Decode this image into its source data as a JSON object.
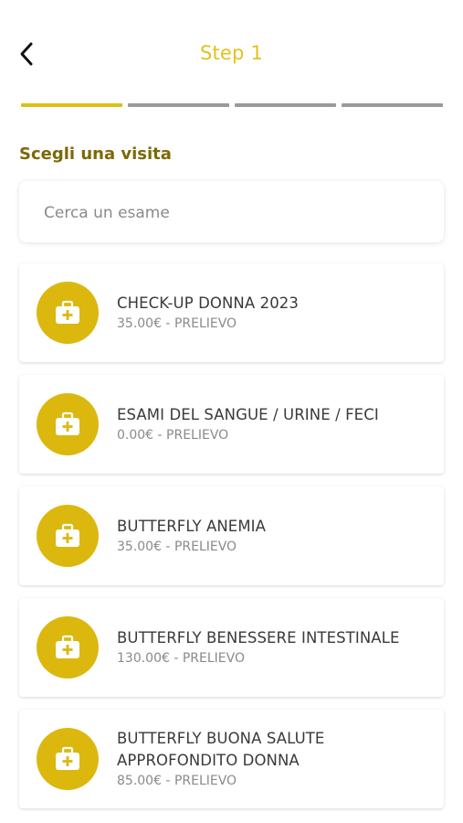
{
  "header": {
    "title": "Step 1",
    "back_icon": "chevron-left-icon"
  },
  "progress": {
    "steps": 4,
    "current": 1
  },
  "section": {
    "title": "Scegli una visita"
  },
  "search": {
    "placeholder": "Cerca un esame",
    "value": ""
  },
  "exams": [
    {
      "name": " CHECK-UP DONNA 2023",
      "meta": "35.00€ - PRELIEVO",
      "icon": "medical-kit-icon"
    },
    {
      "name": " ESAMI DEL SANGUE / URINE / FECI",
      "meta": "0.00€ - PRELIEVO",
      "icon": "medical-kit-icon"
    },
    {
      "name": "BUTTERFLY ANEMIA",
      "meta": "35.00€ - PRELIEVO",
      "icon": "medical-kit-icon"
    },
    {
      "name": "BUTTERFLY BENESSERE INTESTINALE",
      "meta": "130.00€ - PRELIEVO",
      "icon": "medical-kit-icon"
    },
    {
      "name": "BUTTERFLY BUONA SALUTE APPROFONDITO DONNA",
      "meta": "85.00€ - PRELIEVO",
      "icon": "medical-kit-icon"
    }
  ],
  "colors": {
    "accent": "#dcbf11",
    "section_title": "#7c6907",
    "inactive_step": "#9a9a9a"
  }
}
